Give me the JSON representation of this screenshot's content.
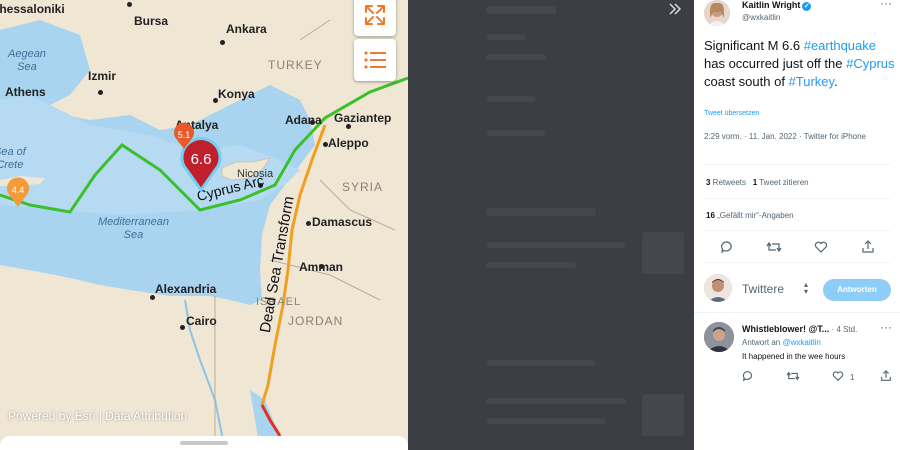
{
  "map": {
    "cities": [
      "Thessaloniki",
      "Bursa",
      "Ankara",
      "Izmir",
      "Konya",
      "Athens",
      "Antalya",
      "Adana",
      "Gaziantep",
      "Aleppo",
      "Nicosia",
      "Damascus",
      "Amman",
      "Alexandria",
      "Cairo"
    ],
    "countries": [
      "TURKEY",
      "SYRIA",
      "ISRAEL",
      "JORDAN"
    ],
    "seas": {
      "aegean": "Aegean\nSea",
      "crete": "Sea of\nCrete",
      "mediterranean": "Mediterranean\nSea"
    },
    "faults": {
      "cyprus_arc": "Cyprus Arc",
      "dead_sea": "Dead Sea Transform"
    },
    "quakes": {
      "main": "6.6",
      "secondary": "5.1",
      "west": "4.4"
    },
    "attribution": "Powered by Esri | Data Attribution",
    "icons": {
      "expand": "expand-arrows-icon",
      "list": "list-icon"
    },
    "colors": {
      "sea": "#a9d4f0",
      "land": "#efe6d4",
      "plate_boundary": "#3bbf2b",
      "transform_fault": "#f0a020",
      "main_pin": "#c0202c",
      "minor_pin": "#f07a2a"
    }
  },
  "middle": {
    "collapse_icon": "double-chevron-right-icon"
  },
  "tweet": {
    "author_name": "Kaitlin Wright",
    "author_handle": "@wxkaitlin",
    "body_prefix": "Significant M 6.6 ",
    "tag_earthquake": "#earthquake",
    "body_mid1": " has occurred just off the ",
    "tag_cyprus": "#Cyprus",
    "body_mid2": " coast south of ",
    "tag_turkey": "#Turkey",
    "body_end": ".",
    "translate": "Tweet übersetzen",
    "meta": "2:29 vorm. · 11. Jan. 2022 · Twitter for iPhone",
    "retweets_count": "3",
    "retweets_label": " Retweets",
    "quotes_count": "1",
    "quotes_label": " Tweet zitieren",
    "likes_count": "16",
    "likes_label": " „Gefällt mir“-Angaben",
    "reply_placeholder": "Twittere",
    "reply_button": "Antworten",
    "reply": {
      "name": "Whistleblower! @T...",
      "time": " · 4 Std.",
      "to_label": "Antwort an ",
      "to_handle": "@wxkaitlin",
      "text": "It happened in the wee hours",
      "likes": "1"
    }
  }
}
